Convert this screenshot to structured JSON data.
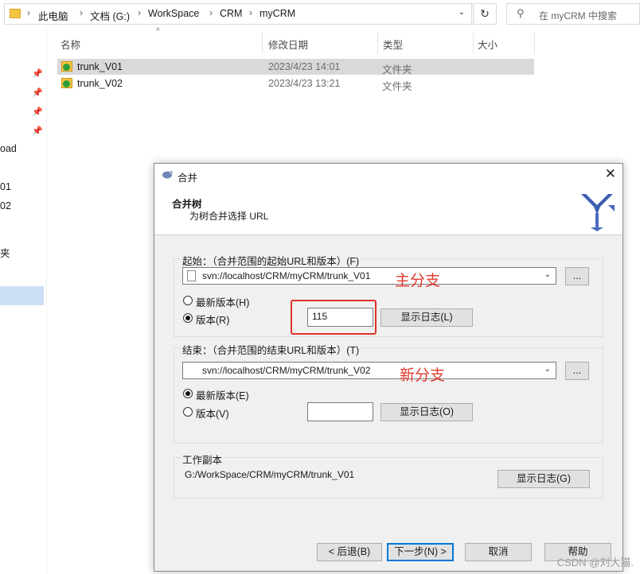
{
  "explorer": {
    "breadcrumb": [
      "此电脑",
      "文档 (G:)",
      "WorkSpace",
      "CRM",
      "myCRM"
    ],
    "search_placeholder": "在 myCRM 中搜索",
    "nav_partial": [
      "oad",
      "01",
      "02",
      "夹"
    ],
    "columns": {
      "name": "名称",
      "modified": "修改日期",
      "type": "类型",
      "size": "大小"
    },
    "rows": [
      {
        "name": "trunk_V01",
        "modified": "2023/4/23 14:01",
        "type": "文件夹"
      },
      {
        "name": "trunk_V02",
        "modified": "2023/4/23 13:21",
        "type": "文件夹"
      }
    ]
  },
  "dialog": {
    "title": "合并",
    "heading": "合并树",
    "subheading": "为树合并选择 URL",
    "start": {
      "label": "起始：（合并范围的起始URL和版本）(F)",
      "url": "svn://localhost/CRM/myCRM/trunk_V01",
      "browse": "...",
      "radio_latest": "最新版本(H)",
      "radio_revision": "版本(R)",
      "revision_value": "115",
      "showlog": "显示日志(L)"
    },
    "end": {
      "label": "结束：（合并范围的结束URL和版本）(T)",
      "url": "svn://localhost/CRM/myCRM/trunk_V02",
      "browse": "...",
      "radio_latest": "最新版本(E)",
      "radio_revision": "版本(V)",
      "revision_value": "",
      "showlog": "显示日志(O)"
    },
    "working_copy": {
      "label": "工作副本",
      "path": "G:/WorkSpace/CRM/myCRM/trunk_V01",
      "showlog": "显示日志(G)"
    },
    "buttons": {
      "back": "< 后退(B)",
      "next": "下一步(N) >",
      "cancel": "取消",
      "help": "帮助"
    }
  },
  "annotations": {
    "main_branch": "主分支",
    "new_branch": "新分支"
  },
  "watermark": "CSDN @刘大猫."
}
